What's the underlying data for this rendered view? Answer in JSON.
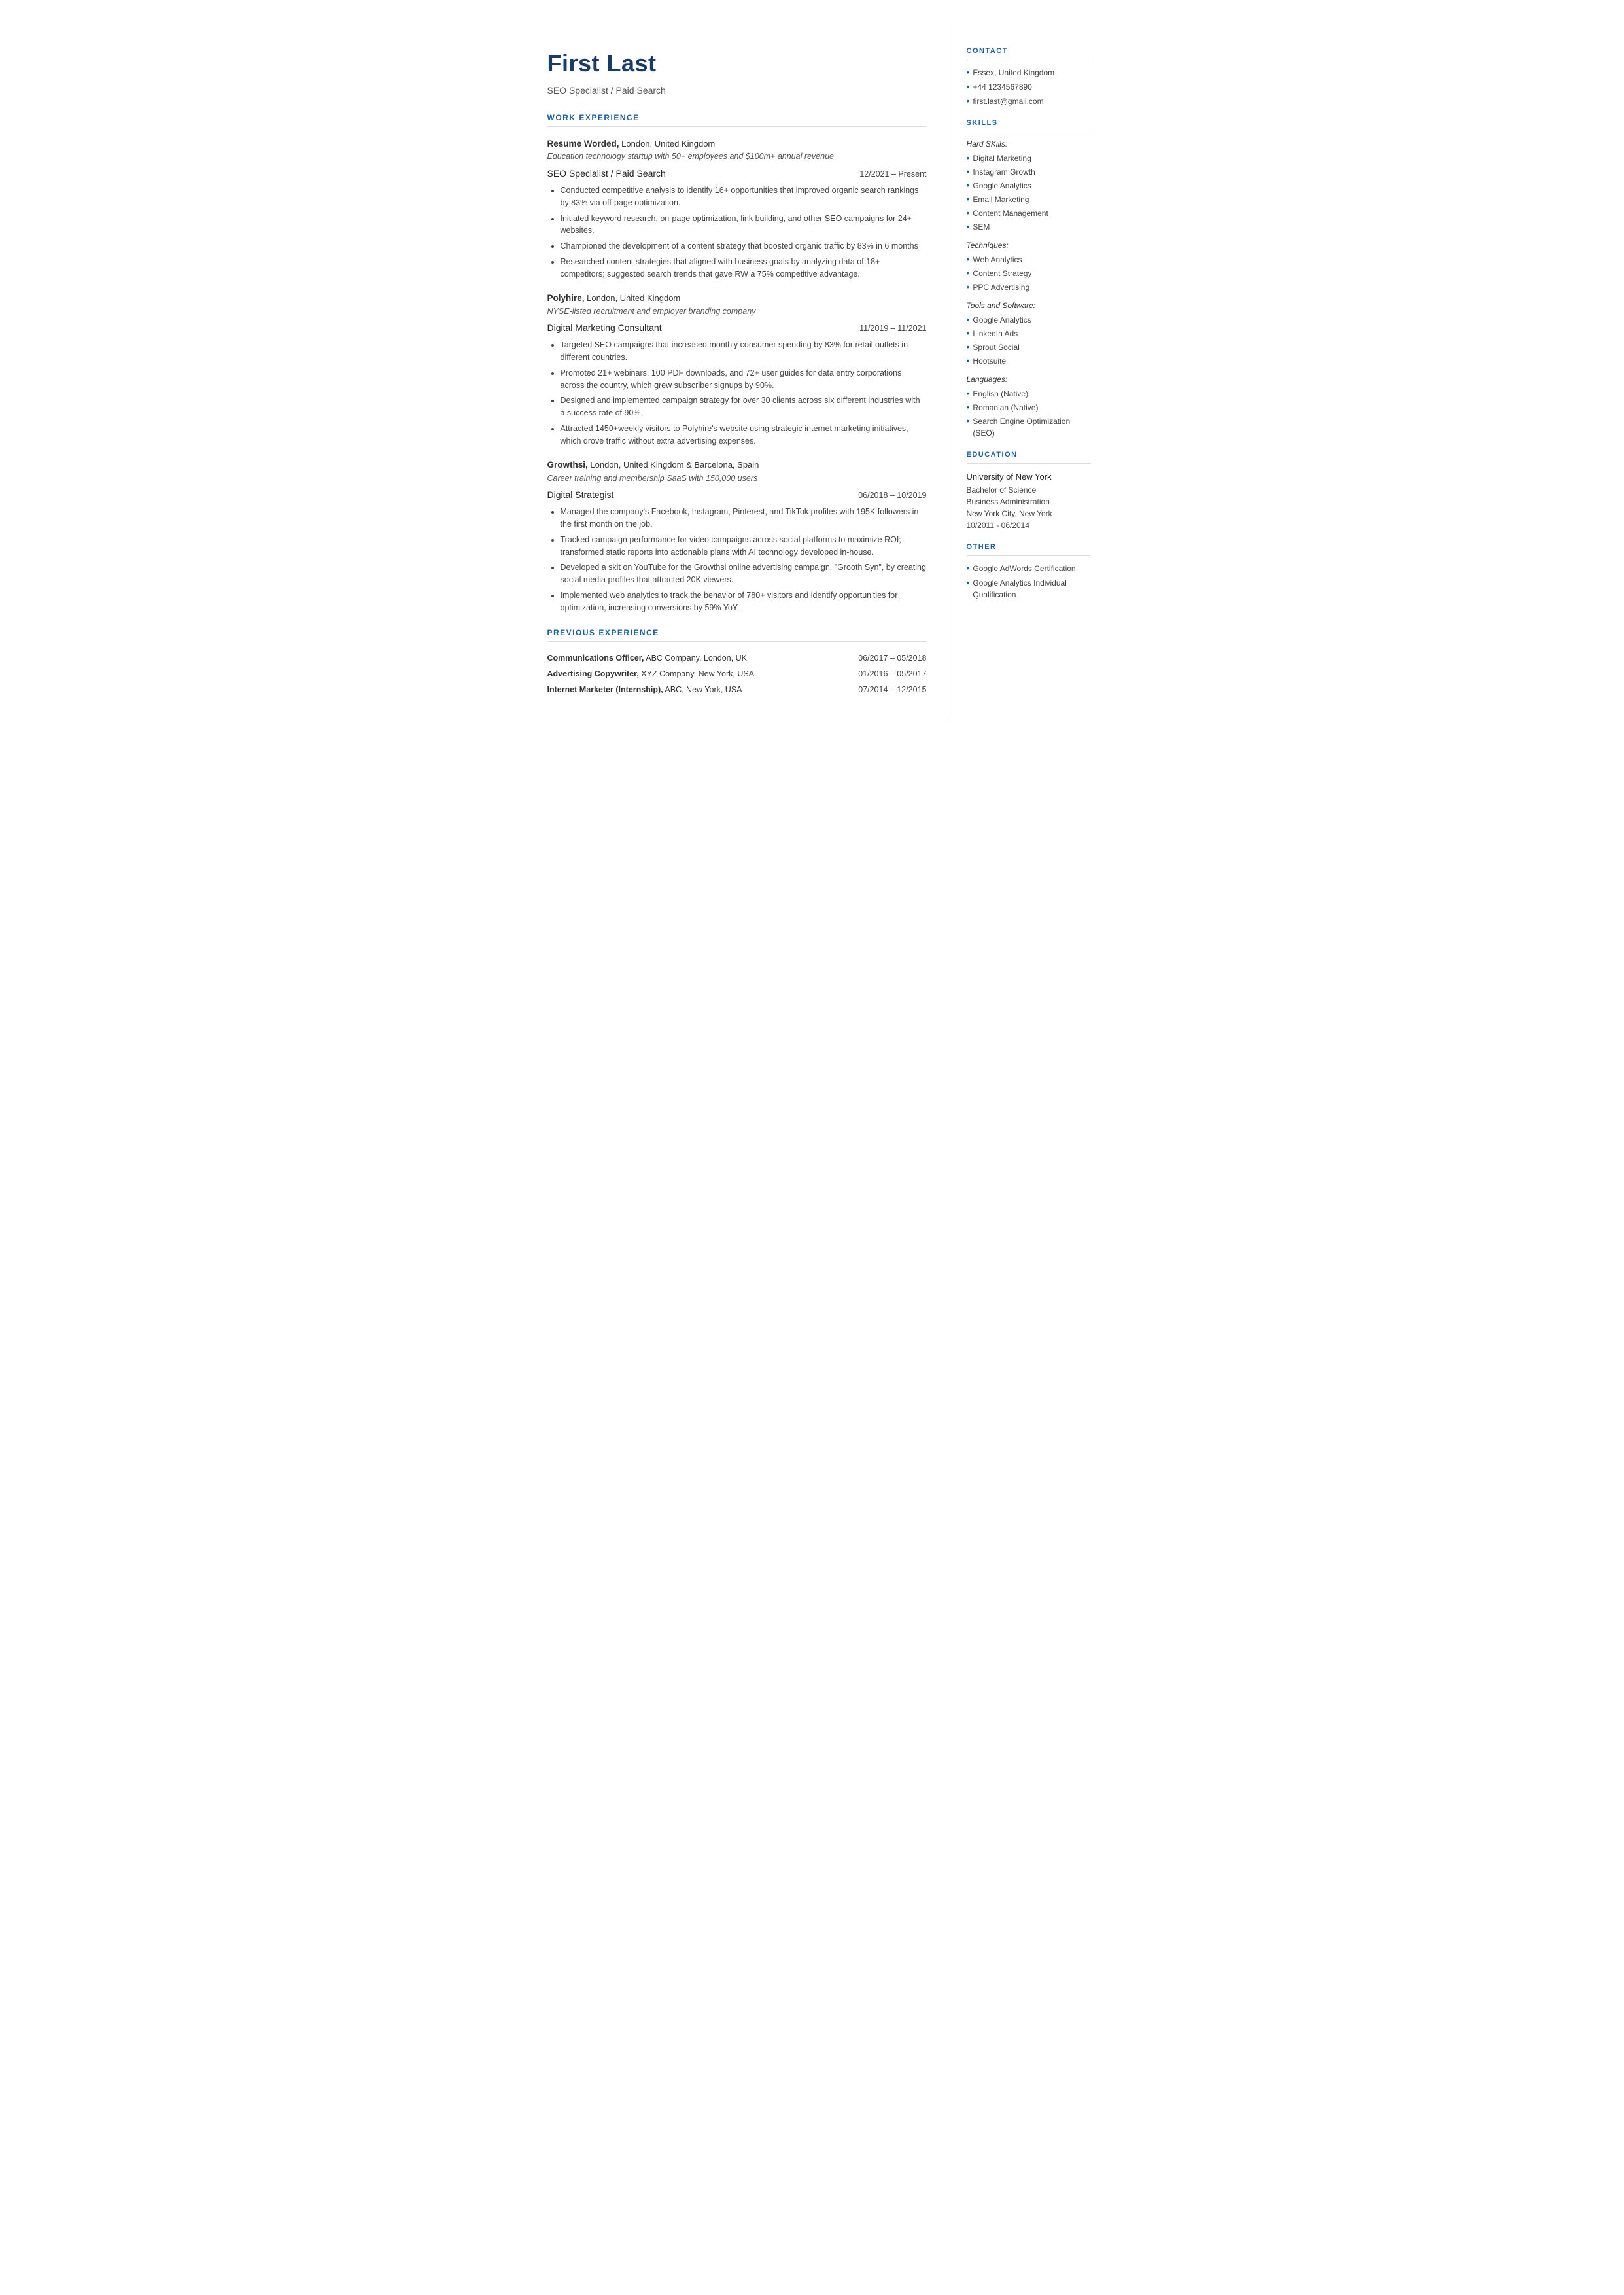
{
  "header": {
    "name": "First Last",
    "title": "SEO Specialist / Paid Search"
  },
  "sections": {
    "work_experience_heading": "WORK EXPERIENCE",
    "previous_experience_heading": "PREVIOUS EXPERIENCE"
  },
  "jobs": [
    {
      "employer": "Resume Worded,",
      "location": "London, United Kingdom",
      "description": "Education technology startup with 50+ employees and $100m+ annual revenue",
      "title": "SEO Specialist / Paid Search",
      "dates": "12/2021 – Present",
      "bullets": [
        "Conducted competitive analysis to identify 16+ opportunities that improved organic search rankings by 83% via off-page optimization.",
        "Initiated keyword research, on-page optimization, link building, and other SEO campaigns for 24+ websites.",
        "Championed the development of a content strategy that boosted organic traffic by 83% in 6 months",
        "Researched content strategies that aligned with business goals by analyzing data of 18+ competitors; suggested search trends that gave RW a 75% competitive advantage."
      ]
    },
    {
      "employer": "Polyhire,",
      "location": "London, United Kingdom",
      "description": "NYSE-listed recruitment and employer branding company",
      "title": "Digital Marketing Consultant",
      "dates": "11/2019 – 11/2021",
      "bullets": [
        "Targeted SEO campaigns that increased monthly consumer spending by 83% for retail outlets in different countries.",
        "Promoted 21+ webinars, 100 PDF downloads, and 72+ user guides for data entry corporations across the country, which grew subscriber signups by 90%.",
        "Designed and implemented campaign strategy for over 30 clients across six different industries with a success rate of 90%.",
        "Attracted 1450+weekly visitors to Polyhire's website using strategic internet marketing initiatives, which drove traffic without extra advertising expenses."
      ]
    },
    {
      "employer": "Growthsi,",
      "location": "London, United Kingdom & Barcelona, Spain",
      "description": "Career training and membership SaaS with 150,000 users",
      "title": "Digital Strategist",
      "dates": "06/2018 – 10/2019",
      "bullets": [
        "Managed the company's Facebook, Instagram, Pinterest, and TikTok profiles with 195K followers in the first month on the job.",
        "Tracked campaign performance for video campaigns across social platforms to maximize ROI; transformed static reports into actionable plans with AI technology developed in-house.",
        "Developed a skit on YouTube for the Growthsi online advertising campaign, \"Grooth Syn\", by creating social media profiles that attracted 20K viewers.",
        "Implemented web analytics to track the behavior of 780+ visitors and identify opportunities for optimization, increasing conversions by 59% YoY."
      ]
    }
  ],
  "previous_experience": [
    {
      "role_bold": "Communications Officer,",
      "role_rest": " ABC Company, London, UK",
      "dates": "06/2017 – 05/2018"
    },
    {
      "role_bold": "Advertising Copywriter,",
      "role_rest": " XYZ Company, New York, USA",
      "dates": "01/2016 – 05/2017"
    },
    {
      "role_bold": "Internet Marketer (Internship),",
      "role_rest": " ABC, New York, USA",
      "dates": "07/2014 – 12/2015"
    }
  ],
  "sidebar": {
    "contact_heading": "CONTACT",
    "contact_items": [
      "Essex, United Kingdom",
      "+44 1234567890",
      "first.last@gmail.com"
    ],
    "skills_heading": "SKILLS",
    "hard_skills_label": "Hard SKills:",
    "hard_skills": [
      "Digital Marketing",
      "Instagram Growth",
      "Google Analytics",
      "Email Marketing",
      "Content Management",
      "SEM"
    ],
    "techniques_label": "Techniques:",
    "techniques": [
      "Web Analytics",
      "Content Strategy",
      "PPC Advertising"
    ],
    "tools_label": "Tools and Software:",
    "tools": [
      "Google Analytics",
      "LinkedIn Ads",
      "Sprout Social",
      "Hootsuite"
    ],
    "languages_label": "Languages:",
    "languages": [
      "English (Native)",
      "Romanian (Native)",
      "Search Engine Optimization (SEO)"
    ],
    "education_heading": "EDUCATION",
    "education": {
      "school": "University of New York",
      "degree": "Bachelor of Science",
      "field": "Business Administration",
      "location": "New York City, New York",
      "dates": "10/2011 - 06/2014"
    },
    "other_heading": "OTHER",
    "other_items": [
      "Google AdWords Certification",
      "Google Analytics Individual Qualification"
    ]
  }
}
